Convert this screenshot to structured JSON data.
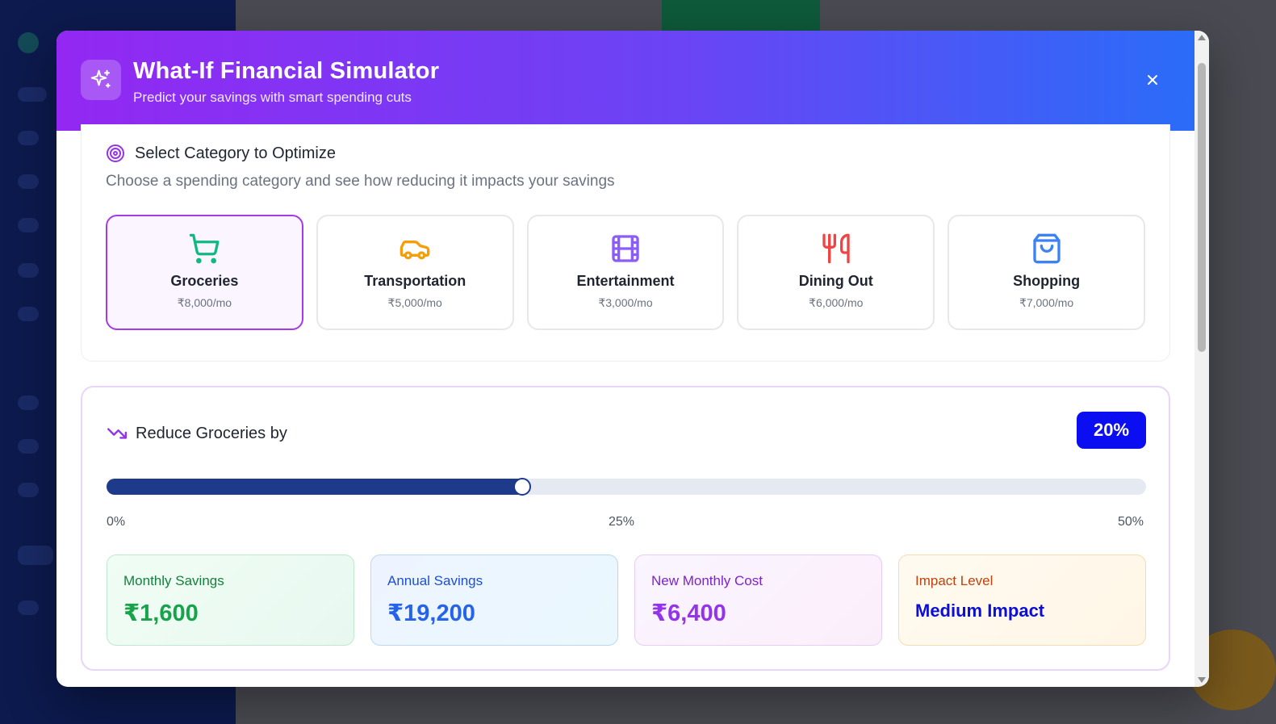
{
  "modal": {
    "title": "What-If Financial Simulator",
    "subtitle": "Predict your savings with smart spending cuts",
    "close_icon": "close-icon"
  },
  "category_section": {
    "heading": "Select Category to Optimize",
    "description": "Choose a spending category and see how reducing it impacts your savings",
    "categories": [
      {
        "name": "Groceries",
        "amount": "₹8,000/mo",
        "icon": "cart-icon",
        "color": "#10b981",
        "selected": true
      },
      {
        "name": "Transportation",
        "amount": "₹5,000/mo",
        "icon": "car-icon",
        "color": "#f59e0b",
        "selected": false
      },
      {
        "name": "Entertainment",
        "amount": "₹3,000/mo",
        "icon": "film-icon",
        "color": "#8b5cf6",
        "selected": false
      },
      {
        "name": "Dining Out",
        "amount": "₹6,000/mo",
        "icon": "utensils-icon",
        "color": "#ef4444",
        "selected": false
      },
      {
        "name": "Shopping",
        "amount": "₹7,000/mo",
        "icon": "shopping-bag-icon",
        "color": "#3b82f6",
        "selected": false
      }
    ]
  },
  "reduce_section": {
    "heading": "Reduce Groceries by",
    "value_label": "20%",
    "slider": {
      "value": 20,
      "min": 0,
      "max": 50
    },
    "ticks": [
      "0%",
      "25%",
      "50%"
    ]
  },
  "stats": [
    {
      "label": "Monthly Savings",
      "value": "₹1,600"
    },
    {
      "label": "Annual Savings",
      "value": "₹19,200"
    },
    {
      "label": "New Monthly Cost",
      "value": "₹6,400"
    },
    {
      "label": "Impact Level",
      "value": "Medium Impact"
    }
  ],
  "colors": {
    "header_gradient_start": "#9328f2",
    "header_gradient_end": "#2a6cf8",
    "selected_border": "#a33be8",
    "badge": "#0a0ef0",
    "slider_fill": "#1e3a8a"
  }
}
